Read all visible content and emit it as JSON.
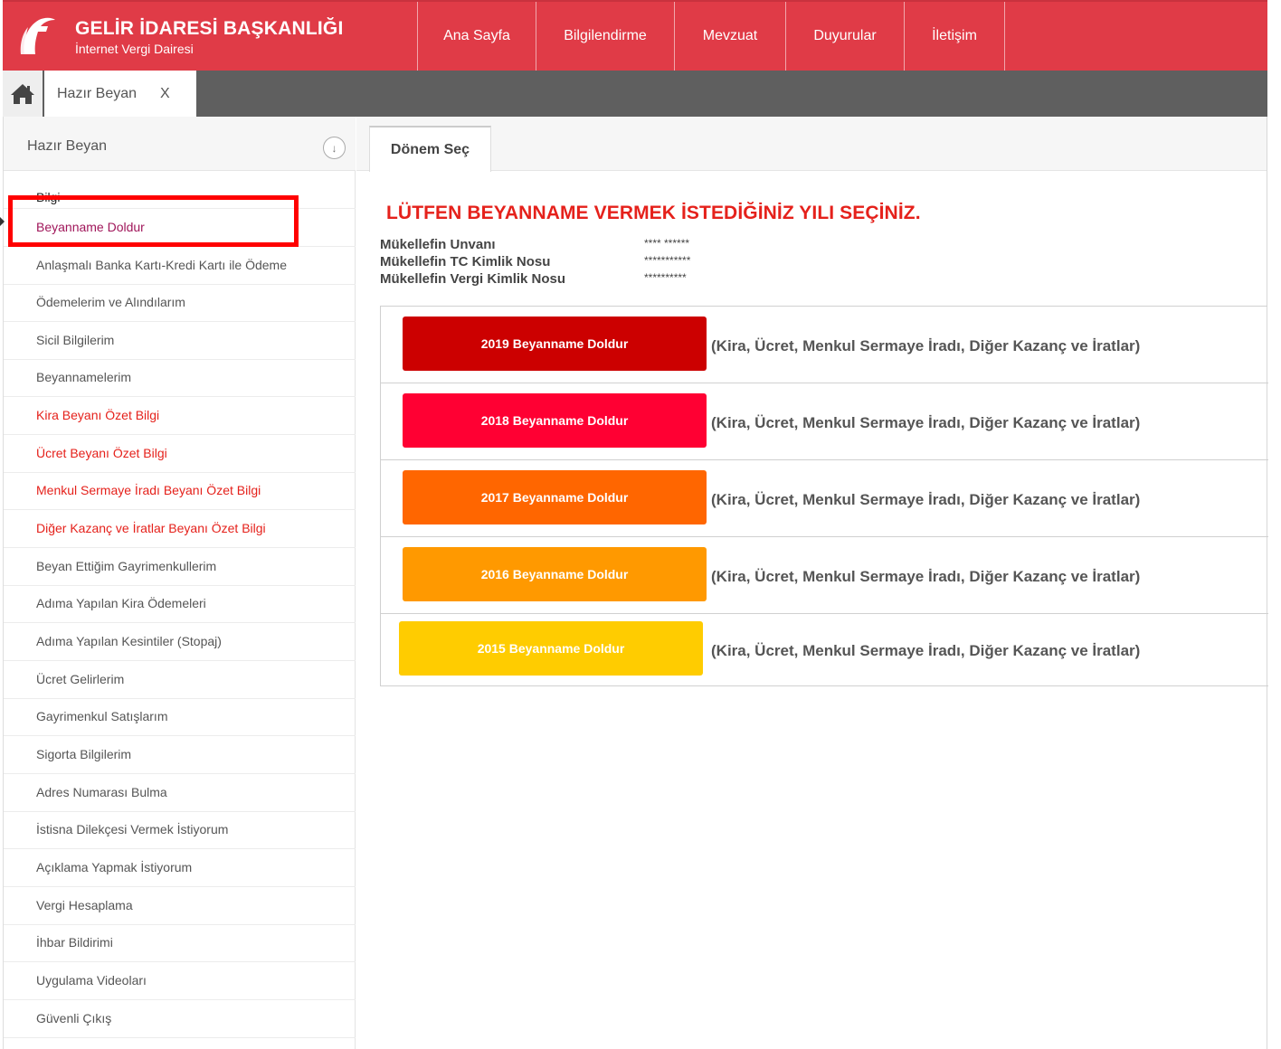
{
  "header": {
    "brand_title": "GELİR İDARESİ BAŞKANLIĞI",
    "brand_subtitle": "İnternet Vergi Dairesi",
    "nav": [
      "Ana Sayfa",
      "Bilgilendirme",
      "Mevzuat",
      "Duyurular",
      "İletişim"
    ],
    "colors": {
      "header_bg": "#e03b47"
    }
  },
  "tabs": {
    "home_icon": "home-icon",
    "open_tab_label": "Hazır Beyan",
    "open_tab_close": "X"
  },
  "sidebar": {
    "title": "Hazır Beyan",
    "collapse_icon": "↓",
    "items": [
      "Bilgi",
      "Beyanname Doldur",
      "Anlaşmalı Banka Kartı-Kredi Kartı ile Ödeme",
      "Ödemelerim ve Alındılarım",
      "Sicil Bilgilerim",
      "Beyannamelerim",
      "Kira Beyanı Özet Bilgi",
      "Ücret Beyanı Özet Bilgi",
      "Menkul Sermaye İradı Beyanı Özet Bilgi",
      "Diğer Kazanç ve İratlar Beyanı Özet Bilgi",
      "Beyan Ettiğim Gayrimenkullerim",
      "Adıma Yapılan Kira Ödemeleri",
      "Adıma Yapılan Kesintiler (Stopaj)",
      "Ücret Gelirlerim",
      "Gayrimenkul Satışlarım",
      "Sigorta Bilgilerim",
      "Adres Numarası Bulma",
      "İstisna Dilekçesi Vermek İstiyorum",
      "Açıklama Yapmak İstiyorum",
      "Vergi Hesaplama",
      "İhbar Bildirimi",
      "Uygulama Videoları",
      "Güvenli Çıkış"
    ],
    "active_item": "Beyanname Doldur",
    "colors": {
      "red_item": "#e5211b",
      "active_item": "#a0165a",
      "highlight": "#ff0000"
    }
  },
  "main": {
    "tab_label": "Dönem Seç",
    "heading": "LÜTFEN BEYANNAME VERMEK İSTEDİĞİNİZ YILI SEÇİNİZ.",
    "info": [
      {
        "label": "Mükellefin Unvanı",
        "value": "**** ******"
      },
      {
        "label": "Mükellefin TC Kimlik Nosu",
        "value": "***********"
      },
      {
        "label": "Mükellefin Vergi Kimlik Nosu",
        "value": "**********"
      }
    ],
    "years": [
      {
        "button": "2019 Beyanname Doldur",
        "description": "(Kira, Ücret, Menkul Sermaye İradı, Diğer Kazanç ve İratlar)",
        "color": "#cc0000"
      },
      {
        "button": "2018 Beyanname Doldur",
        "description": "(Kira, Ücret, Menkul Sermaye İradı, Diğer Kazanç ve İratlar)",
        "color": "#ff0033"
      },
      {
        "button": "2017 Beyanname Doldur",
        "description": "(Kira, Ücret, Menkul Sermaye İradı, Diğer Kazanç ve İratlar)",
        "color": "#ff6600"
      },
      {
        "button": "2016 Beyanname Doldur",
        "description": "(Kira, Ücret, Menkul Sermaye İradı, Diğer Kazanç ve İratlar)",
        "color": "#ff9900"
      },
      {
        "button": "2015 Beyanname Doldur",
        "description": "(Kira, Ücret, Menkul Sermaye İradı, Diğer Kazanç ve İratlar)",
        "color": "#ffcc00"
      }
    ]
  }
}
